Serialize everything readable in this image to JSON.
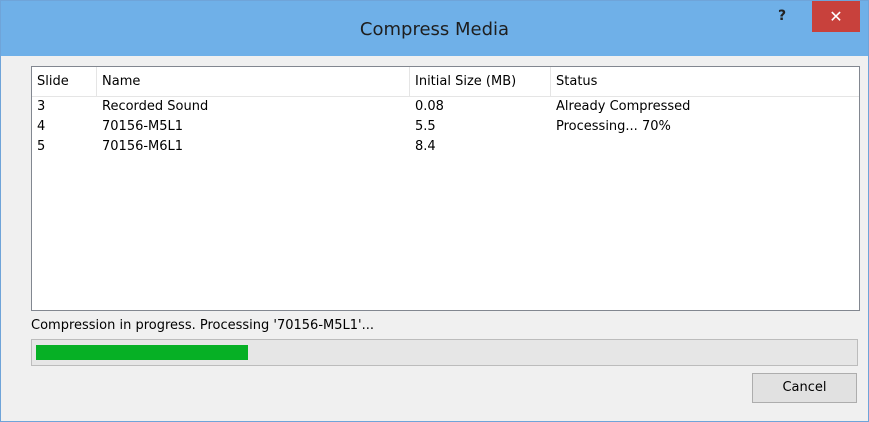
{
  "window": {
    "title": "Compress Media",
    "help_label": "?",
    "close_label": "✕"
  },
  "list": {
    "columns": [
      "Slide",
      "Name",
      "Initial Size (MB)",
      "Status"
    ],
    "rows": [
      {
        "slide": "3",
        "name": "Recorded Sound",
        "size": "0.08",
        "status": "Already Compressed"
      },
      {
        "slide": "4",
        "name": "70156-M5L1",
        "size": "5.5",
        "status": "Processing... 70%"
      },
      {
        "slide": "5",
        "name": "70156-M6L1",
        "size": "8.4",
        "status": ""
      }
    ]
  },
  "progress": {
    "message": "Compression in progress. Processing '70156-M5L1'...",
    "fraction": 0.26,
    "color": "#06b025"
  },
  "buttons": {
    "cancel": "Cancel"
  }
}
